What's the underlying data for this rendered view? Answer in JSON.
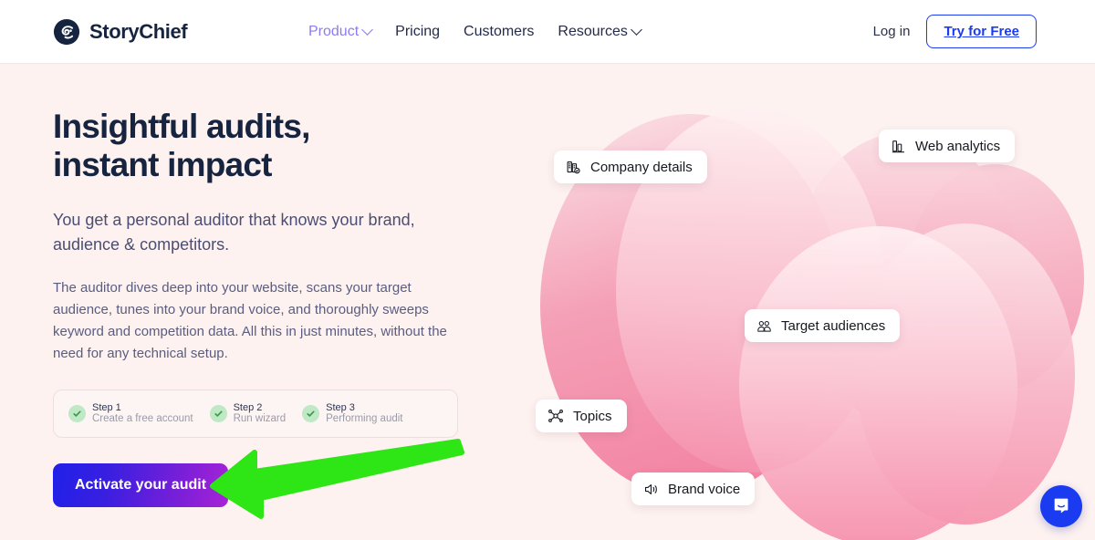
{
  "site": {
    "brand_name": "StoryChief",
    "logo_icon": "storychief-logo-icon",
    "background_color": "#FDF2F0",
    "accent_blue": "#1A3BF0",
    "accent_purple": "#8C7CF0",
    "heading_color": "#16243F"
  },
  "nav": {
    "items": [
      {
        "label": "Product",
        "has_dropdown": true,
        "active": true
      },
      {
        "label": "Pricing",
        "has_dropdown": false,
        "active": false
      },
      {
        "label": "Customers",
        "has_dropdown": false,
        "active": false
      },
      {
        "label": "Resources",
        "has_dropdown": true,
        "active": false
      }
    ],
    "login_label": "Log in",
    "cta_label": "Try for Free"
  },
  "hero": {
    "title": "Insightful audits, instant impact",
    "lead": "You get a personal auditor that knows your brand, audience & competitors.",
    "body": "The auditor dives deep into your website, scans your target audience, tunes into your brand voice, and thoroughly sweeps keyword and competition data. All this in just minutes, without the need for any technical setup.",
    "cta_label": "Activate your audit",
    "cta_gradient_from": "#2020E8",
    "cta_gradient_to": "#A823D6"
  },
  "steps": {
    "check_icon": "check-icon",
    "check_color": "#BFE8C4",
    "items": [
      {
        "name": "Step 1",
        "desc": "Create a free account"
      },
      {
        "name": "Step 2",
        "desc": "Run wizard"
      },
      {
        "name": "Step 3",
        "desc": "Performing audit"
      }
    ]
  },
  "illustration": {
    "pills": [
      {
        "label": "Company details",
        "icon": "company-details-icon"
      },
      {
        "label": "Web analytics",
        "icon": "web-analytics-icon"
      },
      {
        "label": "Target audiences",
        "icon": "target-audiences-icon"
      },
      {
        "label": "Topics",
        "icon": "topics-icon"
      },
      {
        "label": "Brand voice",
        "icon": "brand-voice-icon"
      }
    ],
    "blob_color_light": "#FFF1F3",
    "blob_color_deep": "#F2789B"
  },
  "chat": {
    "icon": "chat-bubble-icon",
    "color": "#1A3BF0"
  },
  "annotation": {
    "arrow_icon": "green-arrow-left-icon",
    "arrow_color": "#2EE516",
    "points_to": "Activate your audit"
  }
}
